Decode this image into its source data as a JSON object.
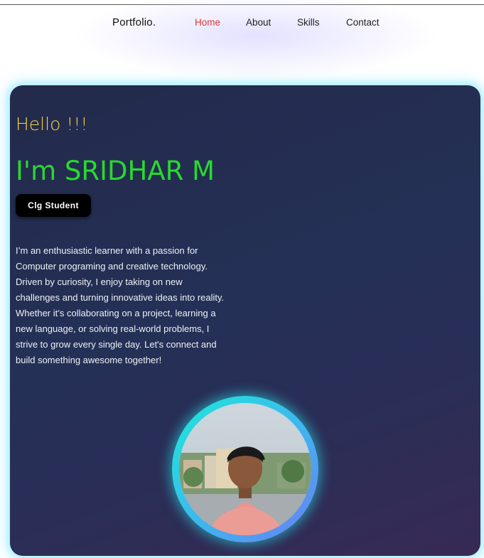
{
  "nav": {
    "brand": "Portfolio.",
    "links": [
      "Home",
      "About",
      "Skills",
      "Contact"
    ],
    "active": "Home"
  },
  "hero": {
    "greeting": "Hello !!!",
    "name": "I'm SRIDHAR M",
    "badge": "Clg Student",
    "bio": "I’m an enthusiastic learner with a passion for Computer programing and creative technology. Driven by curiosity, I enjoy taking on new challenges and turning innovative ideas into reality. Whether it’s collaborating on a project, learning a new language, or solving real-world problems, I strive to grow every single day. Let's connect and build something awesome together!"
  },
  "colors": {
    "accent_active": "#e0383a",
    "greeting": "#f3d34a",
    "name": "#28d930",
    "card_bg": "#243056",
    "avatar_ring": "#1de9d6"
  }
}
